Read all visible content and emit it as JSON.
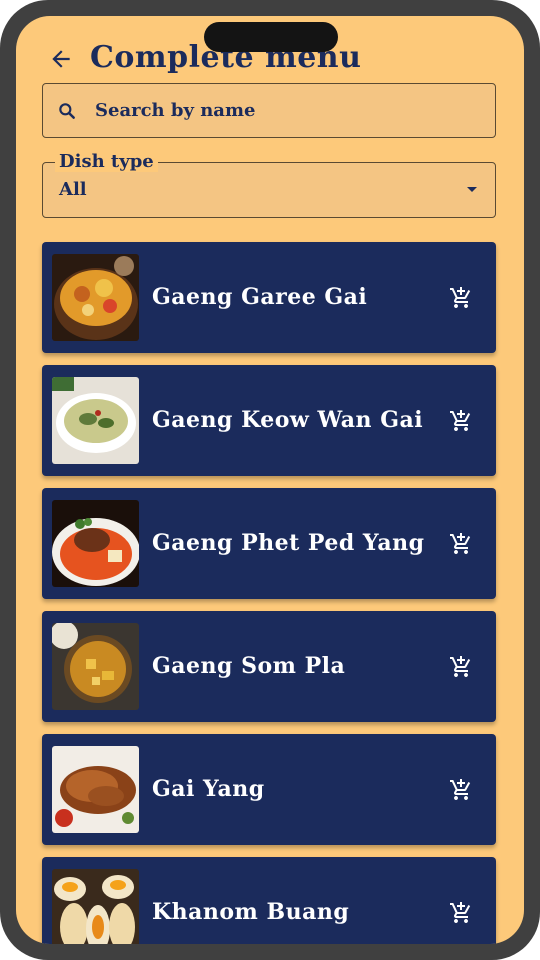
{
  "header": {
    "title": "Complete menu",
    "back_icon": "arrow-left-icon"
  },
  "search": {
    "placeholder": "Search by name",
    "value": "",
    "icon": "search-icon"
  },
  "filter": {
    "label": "Dish type",
    "selected": "All",
    "icon": "caret-down-icon"
  },
  "dishes": [
    {
      "name": "Gaeng Garee Gai",
      "action_icon": "add-to-cart-icon"
    },
    {
      "name": "Gaeng Keow Wan Gai",
      "action_icon": "add-to-cart-icon"
    },
    {
      "name": "Gaeng Phet Ped Yang",
      "action_icon": "add-to-cart-icon"
    },
    {
      "name": "Gaeng Som Pla",
      "action_icon": "add-to-cart-icon"
    },
    {
      "name": "Gai Yang",
      "action_icon": "add-to-cart-icon"
    },
    {
      "name": "Khanom Buang",
      "action_icon": "add-to-cart-icon"
    }
  ],
  "colors": {
    "background": "#fdc97a",
    "card": "#1b2b5c",
    "text_primary": "#1b2b5c",
    "text_on_card": "#ffffff",
    "phone_frame": "#404040"
  }
}
